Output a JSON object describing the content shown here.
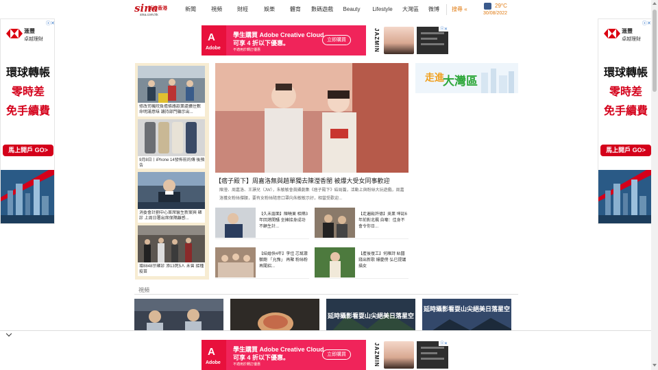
{
  "header": {
    "logo_brand": "sina",
    "logo_cn": "新浪香港",
    "logo_domain": "sina.com.hk",
    "nav": [
      "新聞",
      "視頻",
      "財經",
      "娛樂",
      "體育",
      "數碼遊戲",
      "Beauty",
      "Lifestyle",
      "大灣區",
      "微博"
    ],
    "search": "搜尋 «",
    "weather_temp": "29°C",
    "weather_date": "30/08/2022"
  },
  "side_ad": {
    "bank": "滙豐",
    "sub": "卓越理財",
    "line1": "環球轉帳",
    "line2": "零時差",
    "line3": "免手續費",
    "cta": "馬上開戶 GO>",
    "close": "ⓧ✕"
  },
  "banner": {
    "brand": "Adobe",
    "line1": "學生購買 Adobe Creative Cloud",
    "line2": "可享 4 折以下優惠。",
    "line3": "不適用於轉訂優惠",
    "button": "立即購買",
    "app_name": "JAZMIN",
    "close": "ⓧ✕"
  },
  "left_news": [
    {
      "caption": "修改司機院負擔條路款業處擴住數 命明滿意味 讓持部門顯示出..."
    },
    {
      "caption": "9月8日丨iPhone 14發佈前的傳 後預告"
    },
    {
      "caption": "消委會計劃中心首席醫生新案與 確診 上周日署出席保隔離感..."
    },
    {
      "caption": "增8848宗確診 添13死5人 未曾 接種疫苗"
    }
  ],
  "featured": {
    "title": "【痞子殿下】周嘉洛無與趙單獨去陳瀅香閨 被爆大受女同事歡迎",
    "summary": "陳瀅、周嘉洛、王灝兒（JW），朱敏敏會員攝劇集《痞子殿下》結局篇，活動上與粉絲大玩遊戲，周嘉洛獲女粉絲撐腰，要有女粉絲隨意口罩向朱敏敏示好，相當受歡迎..."
  },
  "mini_news": [
    {
      "caption": "【久未露面】陳曉東 相隔3年回港開騷 坐擁接身成功 不顧生計..."
    },
    {
      "caption": "【走遍殿許德】吳業 坤認6年前對北楓 自嘲：佳身不會令你日..."
    },
    {
      "caption": "【結婚快4年】李佳 芯幫蕭徽飽 「允豫」 再聚 粉絲粉再聞招..."
    },
    {
      "caption": "【產後復工】何雁詩 貼囍錢出新歌 爆慶傍 弘已提議描女"
    }
  ],
  "promo": {
    "a": "走進",
    "b": "大灣區"
  },
  "video": {
    "section_label": "視頻",
    "items": [
      {
        "caption": ""
      },
      {
        "caption": ""
      },
      {
        "caption": "延時攝影看耍山尖絕美日落星空"
      },
      {
        "caption": "延時攝影看耍山尖絕美日落星空"
      }
    ]
  },
  "colors": {
    "brand_red": "#c8161d",
    "accent_orange": "#e07a10",
    "adobe_pink": "#f0245a",
    "hsbc_red": "#d4001a"
  }
}
